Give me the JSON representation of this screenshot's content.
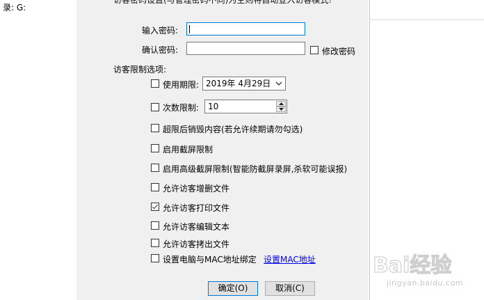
{
  "background": {
    "left_text": "录:  G:"
  },
  "dialog": {
    "top_text": "访客密码设置(与管理密码不同)为空则将自动登入访客模式!",
    "password_label": "输入密码:",
    "password_value": "",
    "confirm_label": "确认密码:",
    "confirm_value": "",
    "change_password_label": "修改密码",
    "change_password_checked": false,
    "section_title": "访客限制选项:",
    "options": {
      "expiry": {
        "label": "使用期限:",
        "checked": false,
        "date": "2019年 4月29日"
      },
      "count": {
        "label": "次数限制:",
        "checked": false,
        "value": "10"
      },
      "destroy": {
        "label": "超限后销毁内容(若允许续期请勿勾选)",
        "checked": false
      },
      "screenshot": {
        "label": "启用截屏限制",
        "checked": false
      },
      "advanced_screenshot": {
        "label": "启用高级截屏限制(智能防截屏录屏,杀软可能误报)",
        "checked": false
      },
      "add_delete": {
        "label": "允许访客增删文件",
        "checked": false
      },
      "print": {
        "label": "允许访客打印文件",
        "checked": true
      },
      "edit": {
        "label": "允许访客编辑文本",
        "checked": false
      },
      "copy": {
        "label": "允许访客拷出文件",
        "checked": false
      },
      "mac_bind": {
        "label": "设置电脑与MAC地址绑定",
        "checked": false,
        "link": "设置MAC地址"
      }
    },
    "ok_label": "确定(O)",
    "cancel_label": "取消(C)"
  },
  "watermark": {
    "brand": "Bai经验",
    "url": "jingyan.baidu.com"
  },
  "colors": {
    "dialog_bg": "#f0f0f0",
    "focus_border": "#0078d7",
    "link": "#0000ee"
  }
}
